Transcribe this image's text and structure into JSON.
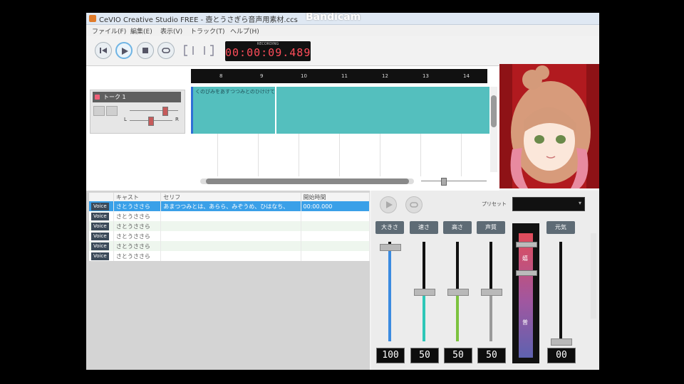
{
  "window": {
    "title": "CeVIO Creative Studio FREE - 壺とうさぎら音声用素材.ccs",
    "watermark": "Bandicam"
  },
  "menu": [
    "ファイル(F)",
    "編集(E)",
    "表示(V)",
    "トラック(T)",
    "ヘルプ(H)"
  ],
  "toolbar": {
    "time_label": "RECORDING",
    "time": "00:00:09.489",
    "buttons": [
      "rewind-button",
      "play-button",
      "stop-button",
      "loop-button",
      "marker-button"
    ]
  },
  "timeline": {
    "ruler_ticks": [
      "8",
      "9",
      "10",
      "11",
      "12",
      "13",
      "14"
    ],
    "track": {
      "name": "トーク 1",
      "pan_left": "L",
      "pan_right": "R"
    },
    "clip_text": "くのぴみをあすつつみとのひけけて"
  },
  "table": {
    "columns": [
      "",
      "キャスト",
      "セリフ",
      "開始時間"
    ],
    "rows": [
      {
        "badge": "Voice",
        "cast": "さとうささら",
        "line": "あまつつみとは、あらら、みぞうめ、ひはなち、",
        "start": "00:00.000",
        "selected": true
      },
      {
        "badge": "Voice",
        "cast": "さとうささら",
        "line": "",
        "start": ""
      },
      {
        "badge": "Voice",
        "cast": "さとうささら",
        "line": "",
        "start": ""
      },
      {
        "badge": "Voice",
        "cast": "さとうささら",
        "line": "",
        "start": ""
      },
      {
        "badge": "Voice",
        "cast": "さとうささら",
        "line": "",
        "start": ""
      },
      {
        "badge": "Voice",
        "cast": "さとうささら",
        "line": "",
        "start": ""
      }
    ]
  },
  "mixer": {
    "preset_label": "プリセット",
    "params": [
      {
        "label": "大きさ",
        "value": "100",
        "level": 0.95,
        "color": "#3b8be0"
      },
      {
        "label": "速さ",
        "value": "50",
        "level": 0.5,
        "color": "#2ec7b8"
      },
      {
        "label": "高さ",
        "value": "50",
        "level": 0.5,
        "color": "#7cc23f"
      },
      {
        "label": "声質",
        "value": "50",
        "level": 0.5,
        "color": "#9a9a9a"
      },
      {
        "label": "元気",
        "value": "00",
        "level": 0.0,
        "color": "#9a9a9a"
      }
    ],
    "emotion": {
      "top_label": "嬉",
      "mid_label": "普"
    }
  },
  "colors": {
    "accent": "#3aa0e8",
    "clip": "#54bfbe",
    "time": "#ff4d5a"
  }
}
